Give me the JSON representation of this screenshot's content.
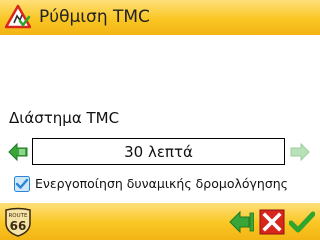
{
  "header": {
    "title": "Ρύθμιση TMC",
    "icon": "warning-route-icon"
  },
  "setting": {
    "label": "Διάστημα TMC",
    "value": "30 λεπτά"
  },
  "checkbox": {
    "label": "Ενεργοποίηση δυναμικής δρομολόγησης",
    "checked": true
  },
  "footer": {
    "logo_top": "ROUTE",
    "logo_number": "66",
    "buttons": [
      "back-button",
      "cancel-button",
      "confirm-button"
    ]
  },
  "colors": {
    "header": "#f9c623",
    "arrow_green": "#3aa63a",
    "arrow_disabled": "#b9e0b9",
    "cancel_red": "#d8261c",
    "check_blue": "#2a86d6"
  }
}
